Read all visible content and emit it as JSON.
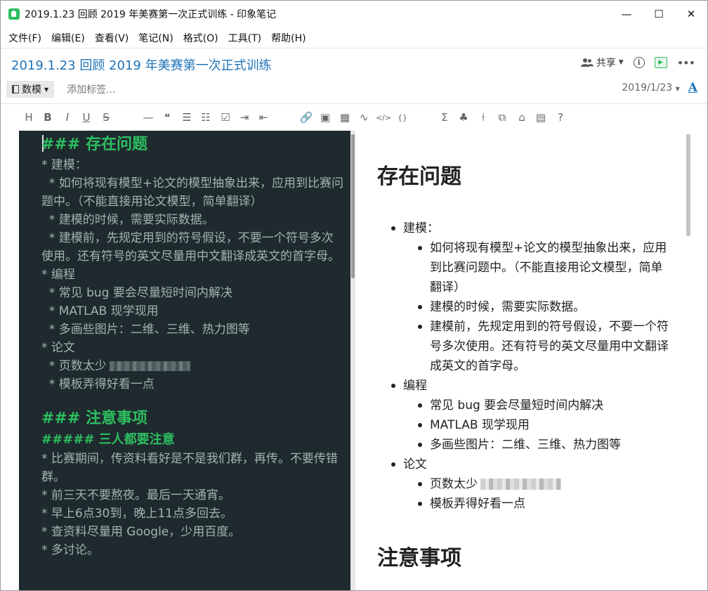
{
  "window": {
    "title": "2019.1.23 回顾 2019 年美赛第一次正式训练 - 印象笔记",
    "minimize": "—",
    "maximize": "☐",
    "close": "✕"
  },
  "menu": [
    "文件(F)",
    "编辑(E)",
    "查看(V)",
    "笔记(N)",
    "格式(O)",
    "工具(T)",
    "帮助(H)"
  ],
  "note": {
    "title": "2019.1.23 回顾 2019 年美赛第一次正式训练",
    "share_label": "共享",
    "notebook": "数模",
    "tag_placeholder": "添加标签...",
    "date": "2019/1/23",
    "font_button": "A"
  },
  "toolbar": {
    "icons": [
      "heading-icon",
      "bold-icon",
      "italic-icon",
      "underline-icon",
      "strikethrough-icon",
      "horizontal-rule-icon",
      "quote-icon",
      "bullet-list-icon",
      "numbered-list-icon",
      "checkbox-icon",
      "indent-icon",
      "outdent-icon",
      "link-icon",
      "image-icon",
      "table-icon",
      "chart-icon",
      "code-icon",
      "code-block-icon",
      "formula-icon",
      "flowchart-icon",
      "sequence-icon",
      "mindmap-icon",
      "theme-icon",
      "outline-icon",
      "help-icon"
    ],
    "glyphs": [
      "H",
      "B",
      "I",
      "U",
      "S",
      "—",
      "❝",
      "☰",
      "☷",
      "☑",
      "⇥",
      "⇤",
      "🔗",
      "▣",
      "▦",
      "∿",
      "</>",
      "{}",
      "Σ",
      "♣",
      "⍿",
      "⧉",
      "⌂",
      "▤",
      "?"
    ]
  },
  "markdown": {
    "lines": [
      {
        "t": "h3",
        "text": "### 存在问题"
      },
      {
        "t": "p",
        "text": "* 建模："
      },
      {
        "t": "p",
        "text": "  * 如何将现有模型+论文的模型抽象出来，应用到比赛问题中。（不能直接用论文模型，简单翻译）",
        "wrap": true
      },
      {
        "t": "p",
        "text": "  * 建模的时候，需要实际数据。"
      },
      {
        "t": "p",
        "text": "  * 建模前，先规定用到的符号假设，不要一个符号多次使用。还有符号的英文尽量用中文翻译成英文的首字母。",
        "wrap": true
      },
      {
        "t": "p",
        "text": "* 编程"
      },
      {
        "t": "p",
        "text": "  * 常见 bug 要会尽量短时间内解决"
      },
      {
        "t": "p",
        "text": "  * MATLAB 现学现用"
      },
      {
        "t": "p",
        "text": "  * 多画些图片：二维、三维、热力图等"
      },
      {
        "t": "p",
        "text": "* 论文"
      },
      {
        "t": "p",
        "text": "  * 页数太少",
        "blur": 115
      },
      {
        "t": "p",
        "text": "  * 模板弄得好看一点"
      },
      {
        "t": "gap",
        "text": ""
      },
      {
        "t": "h3",
        "text": "### 注意事项"
      },
      {
        "t": "h5",
        "text": "##### 三人都要注意"
      },
      {
        "t": "p",
        "text": "* 比赛期间，传资料看好是不是我们群，再传。不要传错群。",
        "wrap": true
      },
      {
        "t": "p",
        "text": "* 前三天不要熬夜。最后一天通宵。"
      },
      {
        "t": "p",
        "text": "* 早上6点30到，晚上11点多回去。"
      },
      {
        "t": "p",
        "text": "* 查资料尽量用 Google，少用百度。"
      },
      {
        "t": "p",
        "text": "* 多讨论。"
      }
    ]
  },
  "preview": {
    "heading1": "存在问题",
    "heading2": "注意事项",
    "items": [
      {
        "label": "建模：",
        "sub": [
          "如何将现有模型+论文的模型抽象出来，应用到比赛问题中。（不能直接用论文模型，简单翻译）",
          "建模的时候，需要实际数据。",
          "建模前，先规定用到的符号假设，不要一个符号多次使用。还有符号的英文尽量用中文翻译成英文的首字母。"
        ]
      },
      {
        "label": "编程",
        "sub": [
          "常见 bug 要会尽量短时间内解决",
          "MATLAB 现学现用",
          "多画些图片：二维、三维、热力图等"
        ]
      },
      {
        "label": "论文",
        "sub": [
          "页数太少",
          "模板弄得好看一点"
        ]
      }
    ]
  }
}
